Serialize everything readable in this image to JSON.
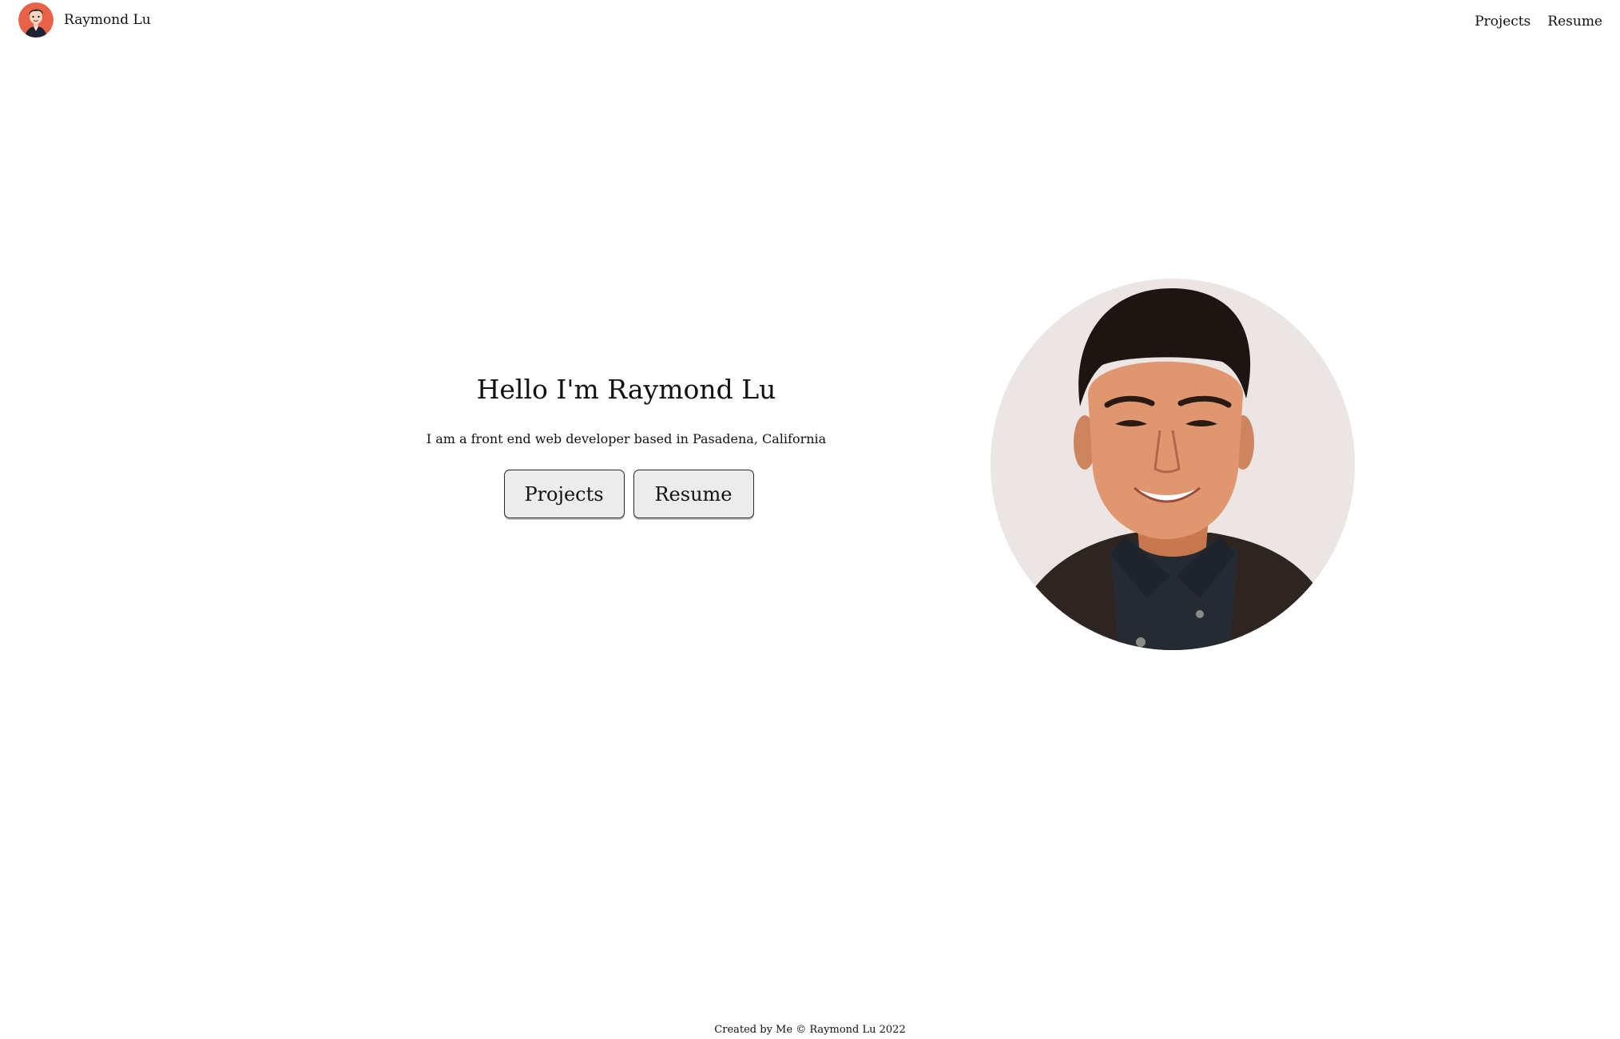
{
  "navbar": {
    "brand_name": "Raymond Lu",
    "links": [
      {
        "label": "Projects"
      },
      {
        "label": "Resume"
      }
    ]
  },
  "hero": {
    "title": "Hello I'm Raymond Lu",
    "subtitle": "I am a front end web developer based in Pasadena, California",
    "buttons": [
      {
        "label": "Projects"
      },
      {
        "label": "Resume"
      }
    ]
  },
  "footer": {
    "text": "Created by Me © Raymond Lu 2022"
  },
  "colors": {
    "background": "#ffffff",
    "logo_background": "#e8624a",
    "button_background": "#ececec",
    "photo_background": "#ebe6e3"
  },
  "icons": {
    "logo": "cartoon-avatar-icon",
    "profile": "profile-photo"
  }
}
